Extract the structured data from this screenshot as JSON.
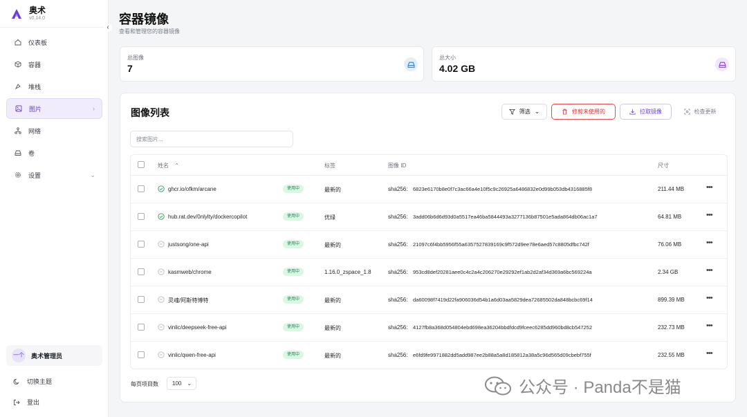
{
  "app": {
    "name": "奥术",
    "version": "v0.14.0"
  },
  "sidebar": {
    "items": [
      {
        "label": "仪表板",
        "icon": "home-icon"
      },
      {
        "label": "容器",
        "icon": "box-icon"
      },
      {
        "label": "堆栈",
        "icon": "layers-icon"
      },
      {
        "label": "图片",
        "icon": "image-icon",
        "active": true
      },
      {
        "label": "网络",
        "icon": "network-icon"
      },
      {
        "label": "卷",
        "icon": "drive-icon"
      },
      {
        "label": "设置",
        "icon": "gear-icon"
      }
    ],
    "user": {
      "avatar": "一个",
      "name": "奥术管理员"
    },
    "theme_label": "切换主题",
    "logout_label": "登出"
  },
  "page": {
    "title": "容器镜像",
    "subtitle": "查看和管理您的容器镜像"
  },
  "stats": [
    {
      "label": "总图像",
      "value": "7",
      "icon": "drive-icon",
      "color": "#2f7fd8"
    },
    {
      "label": "总大小",
      "value": "4.02 GB",
      "icon": "drive-icon",
      "color": "#8b3fd8"
    }
  ],
  "panel": {
    "title": "图像列表",
    "filter_label": "筛选",
    "delete_label": "修剪未使用的",
    "pull_label": "拉取镜像",
    "check_label": "检查更新",
    "search_placeholder": "搜索图片..."
  },
  "table": {
    "columns": {
      "name": "姓名",
      "tag": "标签",
      "id": "图像 ID",
      "size": "尺寸"
    },
    "rows": [
      {
        "name": "ghcr.io/ofkm/arcane",
        "status": "使用中",
        "tag": "最新的",
        "id_prefix": "sha256:",
        "id": "6823e6170b8e0f7c3ac66a4e10f5c9c26925a6486832e0d99b053db4316885f8",
        "size": "211.44 MB",
        "healthy": true
      },
      {
        "name": "hub.rat.dev/0nlylty/dockercopilot",
        "status": "使用中",
        "tag": "优绿",
        "id_prefix": "sha256:",
        "id": "3add06b6d6d93d0a5517ea46ba5844493a3277136b87501e5ada864db06ac1a7",
        "size": "64.81 MB",
        "healthy": true
      },
      {
        "name": "justsong/one-api",
        "status": "使用中",
        "tag": "最新的",
        "id_prefix": "sha256:",
        "id": "21097c6f4bb5956f55a6357527839169c9f572d9ee78e6aed57c8805dfbc742f",
        "size": "76.06 MB",
        "healthy": false
      },
      {
        "name": "kasmweb/chrome",
        "status": "使用中",
        "tag": "1.16.0_zspace_1.8",
        "id_prefix": "sha256:",
        "id": "953cd8def20281aee0c4c2a4c206270e29292ef1ab2d2af34d369a6bc569224a",
        "size": "2.34 GB",
        "healthy": false
      },
      {
        "name": "灵魂/阿斯特博特",
        "status": "使用中",
        "tag": "最新的",
        "id_prefix": "sha256:",
        "id": "da60098f7419d22fa906036d54b1a6d03aa5829dea72685502da848bcbc69f14",
        "size": "899.39 MB",
        "healthy": false
      },
      {
        "name": "vinlic/deepseek-free-api",
        "status": "使用中",
        "tag": "最新的",
        "id_prefix": "sha256:",
        "id": "4127fb8a368d054804ebd698ea36204bbdfdcd9fceec6285dd960bd8cb547252",
        "size": "232.73 MB",
        "healthy": false
      },
      {
        "name": "vinlic/qwen-free-api",
        "status": "使用中",
        "tag": "最新的",
        "id_prefix": "sha256:",
        "id": "e6fd9fe9971882dd5add987ee2b88a5a8d185812a38a5c96d565d09cbebf755f",
        "size": "232.55 MB",
        "healthy": false
      }
    ]
  },
  "pagination": {
    "per_page_label": "每页项目数",
    "per_page_value": "100"
  },
  "watermark": {
    "text": "公众号 · Panda不是猫"
  }
}
